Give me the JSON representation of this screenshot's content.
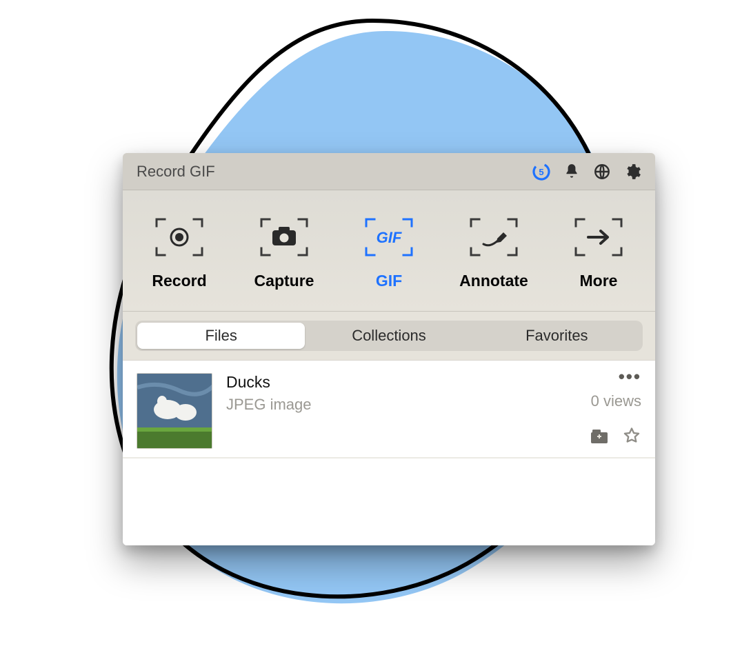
{
  "header": {
    "title": "Record GIF",
    "timer_value": "5"
  },
  "toolbar": {
    "items": [
      {
        "label": "Record",
        "active": false
      },
      {
        "label": "Capture",
        "active": false
      },
      {
        "label": "GIF",
        "active": true
      },
      {
        "label": "Annotate",
        "active": false
      },
      {
        "label": "More",
        "active": false
      }
    ],
    "gif_badge_text": "GIF"
  },
  "segments": {
    "items": [
      {
        "label": "Files",
        "active": true
      },
      {
        "label": "Collections",
        "active": false
      },
      {
        "label": "Favorites",
        "active": false
      }
    ]
  },
  "files": [
    {
      "name": "Ducks",
      "type": "JPEG image",
      "views_text": "0 views"
    }
  ]
}
